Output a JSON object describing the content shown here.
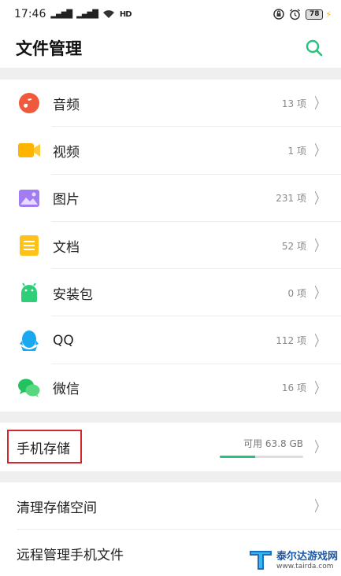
{
  "status": {
    "time": "17:46",
    "signal_1": "4G",
    "signal_2": "4G",
    "hd": "HD",
    "battery": "78"
  },
  "header": {
    "title": "文件管理"
  },
  "categories": [
    {
      "label": "音频",
      "count": "13 项"
    },
    {
      "label": "视频",
      "count": "1 项"
    },
    {
      "label": "图片",
      "count": "231 项"
    },
    {
      "label": "文档",
      "count": "52 项"
    },
    {
      "label": "安装包",
      "count": "0 项"
    },
    {
      "label": "QQ",
      "count": "112 项"
    },
    {
      "label": "微信",
      "count": "16 项"
    }
  ],
  "storage": {
    "label": "手机存储",
    "free": "可用 63.8 GB",
    "used_fraction": 0.42
  },
  "tools": [
    {
      "label": "清理存储空间"
    },
    {
      "label": "远程管理手机文件"
    }
  ],
  "watermark": {
    "name": "泰尔达游戏网",
    "url": "www.tairda.com"
  },
  "colors": {
    "accent": "#24c27c",
    "highlight_box": "#d0282c"
  }
}
